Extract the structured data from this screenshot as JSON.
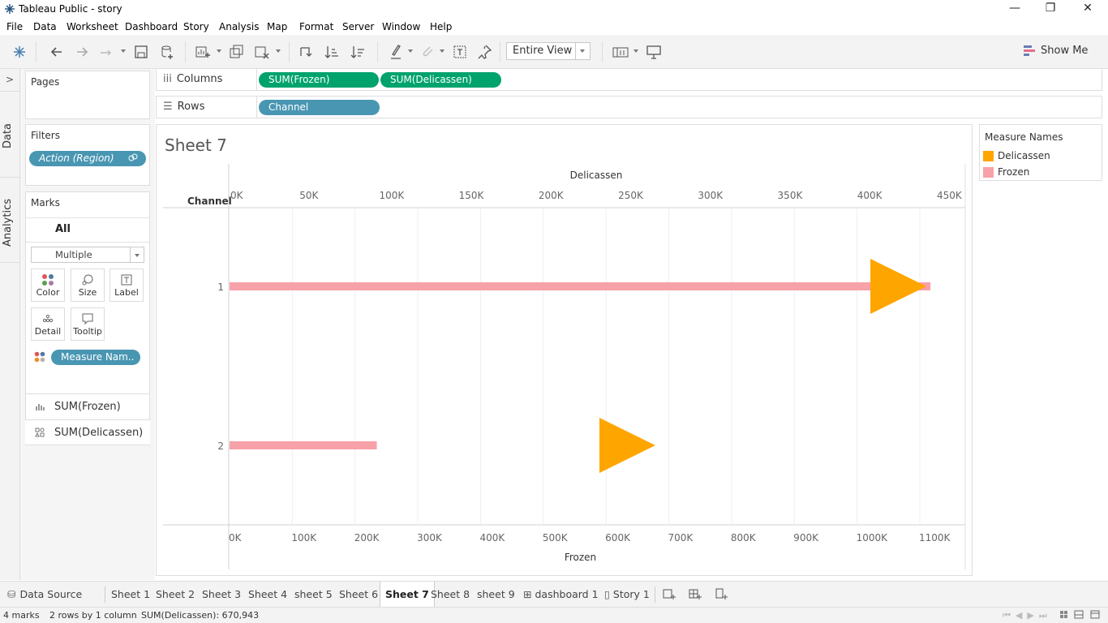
{
  "window": {
    "title": "Tableau Public - story",
    "minimize_glyph": "—",
    "restore_glyph": "❐",
    "close_glyph": "✕"
  },
  "menu": [
    "File",
    "Data",
    "Worksheet",
    "Dashboard",
    "Story",
    "Analysis",
    "Map",
    "Format",
    "Server",
    "Window",
    "Help"
  ],
  "toolbar": {
    "view_mode": "Entire View",
    "show_me": "Show Me"
  },
  "side_tabs": {
    "data": "Data",
    "analytics": "Analytics"
  },
  "panes": {
    "pages": "Pages",
    "filters": "Filters",
    "marks": "Marks",
    "marks_all": "All",
    "mark_type": "Multiple"
  },
  "filters": [
    {
      "label": "Action (Region)"
    }
  ],
  "marks_buttons": [
    {
      "label": "Color",
      "icon": "color-dots-icon"
    },
    {
      "label": "Size",
      "icon": "size-icon"
    },
    {
      "label": "Label",
      "icon": "label-icon"
    },
    {
      "label": "Detail",
      "icon": "detail-icon"
    },
    {
      "label": "Tooltip",
      "icon": "tooltip-icon"
    }
  ],
  "marks_pill": "Measure Nam..",
  "measure_cards": [
    {
      "label": "SUM(Frozen)",
      "icon": "bar-chart-icon"
    },
    {
      "label": "SUM(Delicassen)",
      "icon": "shape-icon"
    }
  ],
  "shelves": {
    "columns_label": "Columns",
    "rows_label": "Rows",
    "columns_pills": [
      "SUM(Frozen)",
      "SUM(Delicassen)"
    ],
    "rows_pills": [
      "Channel"
    ]
  },
  "sheet": {
    "title": "Sheet 7"
  },
  "legend": {
    "title": "Measure Names",
    "items": [
      {
        "label": "Delicassen",
        "color": "#FFA500"
      },
      {
        "label": "Frozen",
        "color": "#F7A1A8"
      }
    ]
  },
  "chart_data": {
    "type": "bar",
    "row_header": "Channel",
    "categories": [
      "1",
      "2"
    ],
    "top_axis": {
      "label": "Delicassen",
      "range": [
        0,
        450000
      ],
      "ticks": [
        "0K",
        "50K",
        "100K",
        "150K",
        "200K",
        "250K",
        "300K",
        "350K",
        "400K",
        "450K"
      ]
    },
    "bottom_axis": {
      "label": "Frozen",
      "range": [
        0,
        1100000
      ],
      "ticks": [
        "0K",
        "100K",
        "200K",
        "300K",
        "400K",
        "500K",
        "600K",
        "700K",
        "800K",
        "900K",
        "1000K",
        "1100K"
      ]
    },
    "series": [
      {
        "name": "Frozen",
        "mark": "bar",
        "axis": "bottom",
        "color": "#F7A1A8",
        "values": [
          1116979,
          234671
        ]
      },
      {
        "name": "Delicassen",
        "mark": "triangle",
        "axis": "top",
        "color": "#FFA500",
        "values": [
          420495,
          250448
        ]
      }
    ],
    "grid": true
  },
  "tabs": {
    "data_source": "Data Source",
    "sheets": [
      "Sheet 1",
      "Sheet 2",
      "Sheet 3",
      "Sheet 4",
      "sheet 5",
      "Sheet 6",
      "Sheet 7",
      "Sheet 8",
      "sheet 9"
    ],
    "dashboard": "dashboard 1",
    "story": "Story 1",
    "active": "Sheet 7"
  },
  "status": {
    "marks": "4 marks",
    "rows": "2 rows by 1 column",
    "sum": "SUM(Delicassen): 670,943"
  }
}
